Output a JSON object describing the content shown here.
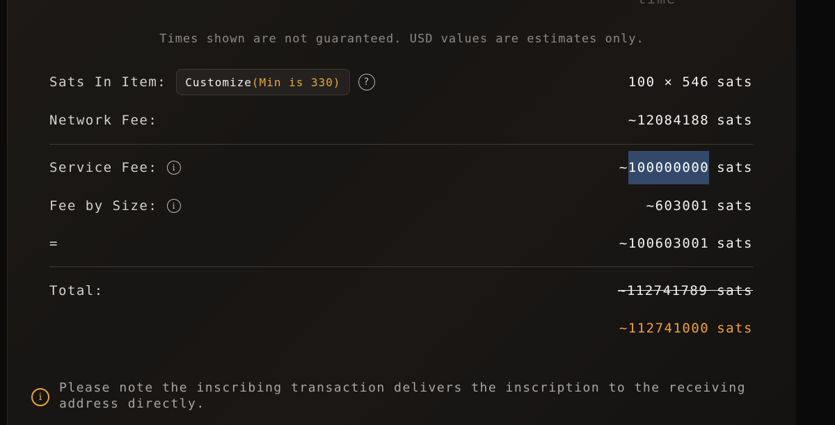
{
  "header": {
    "cut_heading": "time",
    "disclaimer": "Times shown are not guaranteed. USD values are estimates only."
  },
  "sats_in_item": {
    "label": "Sats In Item:",
    "customize_label": "Customize",
    "customize_min": "(Min is 330)",
    "help_glyph": "?",
    "value": "100 × 546",
    "unit": "sats"
  },
  "network_fee": {
    "label": "Network Fee:",
    "value": "~12084188",
    "unit": "sats"
  },
  "service_fee": {
    "label": "Service Fee:",
    "prefix": "~",
    "value": "100000000",
    "unit": "sats",
    "selected": true
  },
  "fee_by_size": {
    "label": "Fee by Size:",
    "value": "~603001",
    "unit": "sats"
  },
  "subtotal": {
    "label": "=",
    "value": "~100603001",
    "unit": "sats"
  },
  "total": {
    "label": "Total:",
    "original_value": "~112741789 sats",
    "discounted_value": "~112741000",
    "unit": "sats"
  },
  "note": {
    "text": "Please note the inscribing transaction delivers the inscription to the receiving address directly."
  },
  "icons": {
    "info": "i",
    "warning": "i"
  },
  "colors": {
    "accent": "#f0a03c",
    "selection": "#34496a",
    "background": "#1a1715"
  }
}
